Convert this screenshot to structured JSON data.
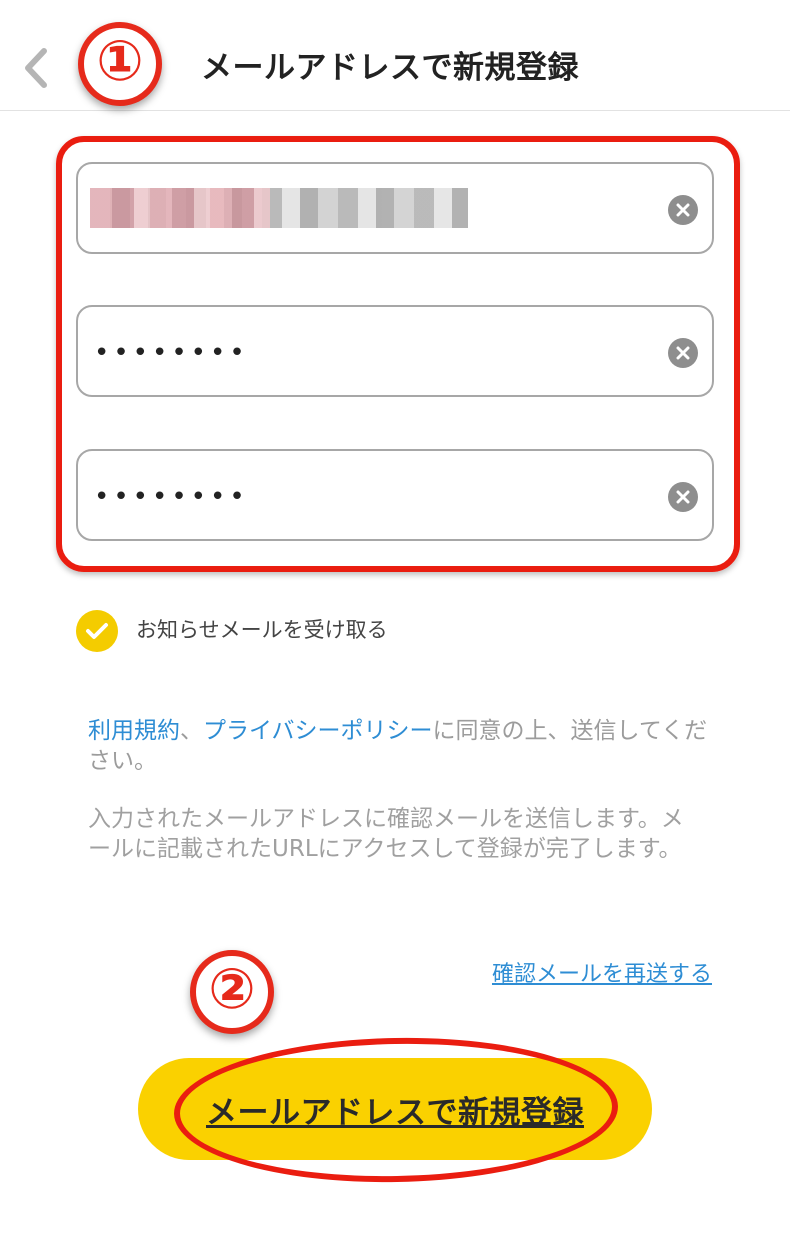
{
  "header": {
    "title": "メールアドレスで新規登録",
    "back_icon": "chevron-left-icon"
  },
  "annotations": {
    "step1": "①",
    "step2": "②"
  },
  "form": {
    "email_value": "",
    "password_value": "••••••••",
    "password_confirm_value": "••••••••",
    "clear_icon": "close-circle-icon"
  },
  "newsletter": {
    "checked": true,
    "label": "お知らせメールを受け取る"
  },
  "terms": {
    "link_terms": "利用規約",
    "separator": "、",
    "link_privacy": "プライバシーポリシー",
    "suffix": "に同意の上、送信してください。"
  },
  "info": {
    "text": "入力されたメールアドレスに確認メールを送信します。メールに記載されたURLにアクセスして登録が完了します。"
  },
  "resend": {
    "label": "確認メールを再送する"
  },
  "submit": {
    "label": "メールアドレスで新規登録"
  },
  "colors": {
    "accent_yellow": "#fad100",
    "link_blue": "#2e8dd4",
    "annotation_red": "#ea1d10"
  }
}
